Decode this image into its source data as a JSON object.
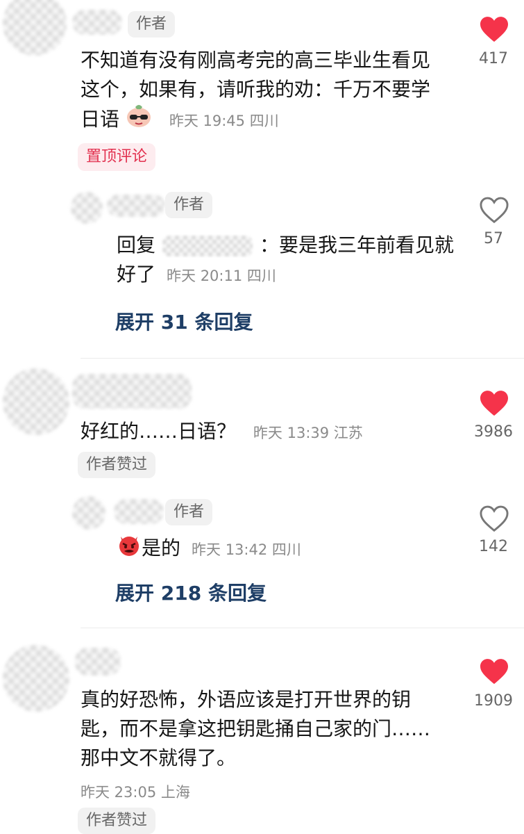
{
  "comments": [
    {
      "author_tag": "作者",
      "text": "不知道有没有刚高考完的高三毕业生看见这个，如果有，请听我的劝：千万不要学日语",
      "time": "昨天 19:45 四川",
      "pin_label": "置顶评论",
      "like_count": "417",
      "liked": true,
      "reply": {
        "author_tag": "作者",
        "reply_prefix": "回复",
        "text": "：要是我三年前看见就好了",
        "time": "昨天 20:11 四川",
        "like_count": "57",
        "liked": false
      },
      "expand_label": "展开 31 条回复"
    },
    {
      "text": "好红的……日语？",
      "time": "昨天 13:39 江苏",
      "badge": "作者赞过",
      "like_count": "3986",
      "liked": true,
      "reply": {
        "author_tag": "作者",
        "text": "是的",
        "time": "昨天 13:42 四川",
        "like_count": "142",
        "liked": false
      },
      "expand_label": "展开 218 条回复"
    },
    {
      "text": "真的好恐怖，外语应该是打开世界的钥匙，而不是拿这把钥匙捅自己家的门……那中文不就得了。",
      "time": "昨天 23:05 上海",
      "badge": "作者赞过",
      "like_count": "1909",
      "liked": true
    }
  ],
  "colors": {
    "like_active": "#f5334a",
    "expand_text": "#1e3e66",
    "pin_text": "#e2314f"
  },
  "icons": [
    "heart-filled-icon",
    "heart-outline-icon",
    "sunglasses-emoji-icon",
    "devil-emoji-icon"
  ]
}
